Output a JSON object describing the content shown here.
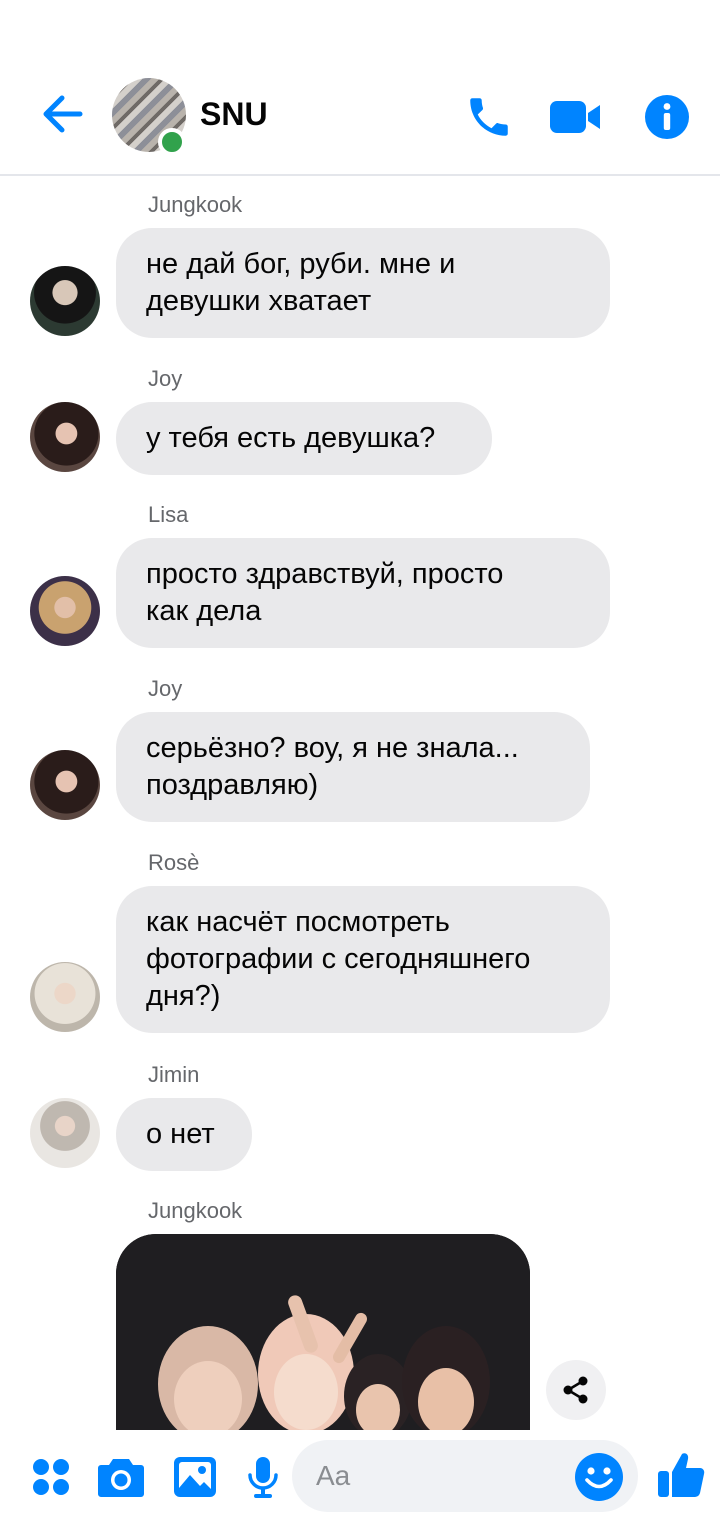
{
  "header": {
    "title": "SNU",
    "back_icon": "arrow-left-icon",
    "call_icon": "phone-icon",
    "video_icon": "video-camera-icon",
    "info_icon": "info-icon",
    "accent_color": "#0084ff",
    "online_color": "#31a24c"
  },
  "messages": [
    {
      "sender": "Jungkook",
      "lines": [
        "не дай бог, руби. мне и",
        "девушки хватает"
      ]
    },
    {
      "sender": "Joy",
      "lines": [
        "у тебя есть девушка?"
      ]
    },
    {
      "sender": "Lisa",
      "lines": [
        "просто здравствуй, просто",
        "как дела"
      ]
    },
    {
      "sender": "Joy",
      "lines": [
        "серьёзно? воу, я не знала...",
        "поздравляю)"
      ]
    },
    {
      "sender": "Rosè",
      "lines": [
        "как насчёт посмотреть",
        "фотографии с сегодняшнего",
        "дня?)"
      ]
    },
    {
      "sender": "Jimin",
      "lines": [
        "о нет"
      ]
    },
    {
      "sender": "Jungkook",
      "attachment": "photo"
    }
  ],
  "composer": {
    "placeholder": "Aa",
    "apps_icon": "apps-grid-icon",
    "camera_icon": "camera-icon",
    "gallery_icon": "image-icon",
    "mic_icon": "microphone-icon",
    "emoji_icon": "smiley-icon",
    "like_icon": "thumbs-up-icon"
  }
}
